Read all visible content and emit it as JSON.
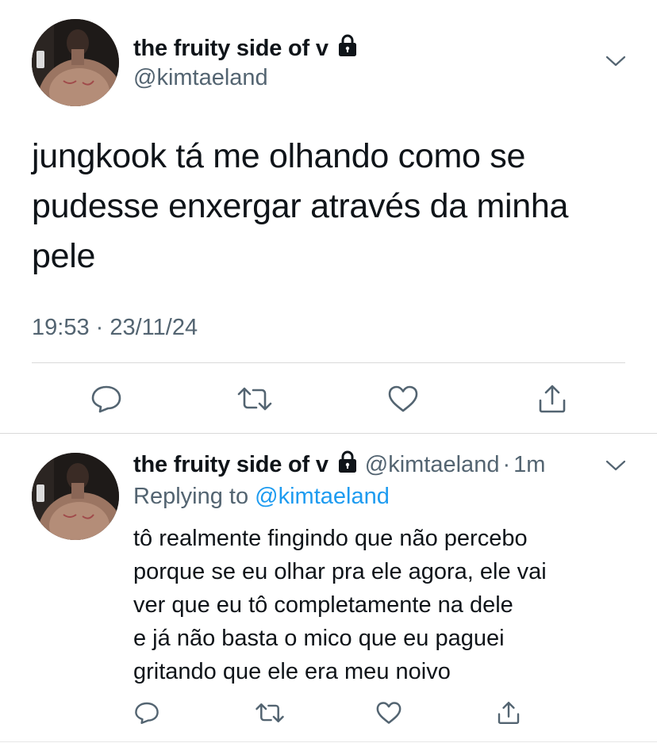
{
  "main_tweet": {
    "display_name": "the fruity side of v",
    "handle": "@kimtaeland",
    "text": "jungkook tá me olhando como se pudesse enxergar através da minha pele",
    "timestamp": "19:53 · 23/11/24",
    "icons": {
      "lock": "lock-icon",
      "more": "chevron-down-icon",
      "reply": "reply-icon",
      "retweet": "retweet-icon",
      "like": "heart-icon",
      "share": "share-icon"
    }
  },
  "reply_tweet": {
    "display_name": "the fruity side of v",
    "handle": "@kimtaeland",
    "separator": "·",
    "relative_time": "1m",
    "replying_to_label": "Replying to",
    "replying_to_handle": "@kimtaeland",
    "lines": [
      "tô realmente fingindo que não percebo",
      "porque se eu olhar pra ele agora, ele vai",
      "ver que eu tô completamente na dele",
      "e já não basta o mico que eu paguei",
      "gritando que ele era meu noivo"
    ]
  },
  "colors": {
    "text_primary": "#0f1419",
    "text_secondary": "#536471",
    "link": "#1d9bf0",
    "icon": "#536471",
    "divider": "#d9d9d9"
  }
}
